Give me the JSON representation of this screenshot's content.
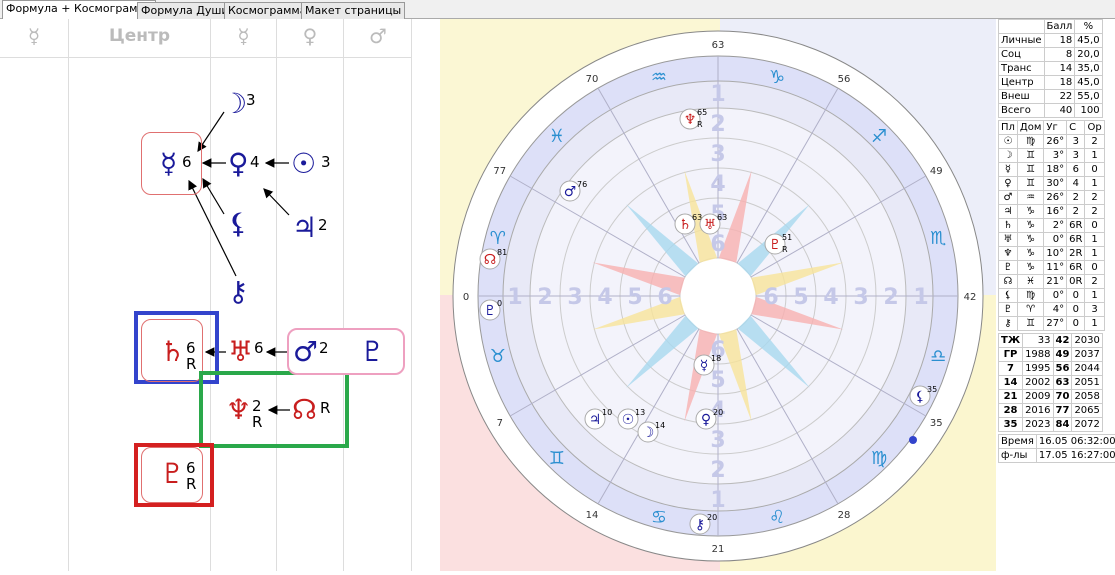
{
  "tabs": [
    "Формула + Космограмма",
    "Формула Души",
    "Космограмма",
    "Макет страницы"
  ],
  "formula": {
    "headers": [
      "☿",
      "Центр",
      "☿",
      "♀",
      "♂"
    ],
    "planets": [
      {
        "key": "moon",
        "glyph": "☽",
        "num": "3",
        "color": "#1a1a9a"
      },
      {
        "key": "mercury",
        "glyph": "☿",
        "num": "6",
        "color": "#1a1a9a"
      },
      {
        "key": "venus",
        "glyph": "♀",
        "num": "4",
        "color": "#1a1a9a"
      },
      {
        "key": "sun",
        "glyph": "☉",
        "num": "3",
        "color": "#1a1a9a"
      },
      {
        "key": "lilith",
        "glyph": "⚸",
        "num": "",
        "color": "#1a1a9a"
      },
      {
        "key": "jupiter",
        "glyph": "♃",
        "num": "2",
        "color": "#1a1a9a"
      },
      {
        "key": "chiron",
        "glyph": "⚷",
        "num": "",
        "color": "#1a1a9a"
      },
      {
        "key": "saturn",
        "glyph": "♄",
        "num": "6",
        "r": "R",
        "color": "#c81e1e"
      },
      {
        "key": "uranus",
        "glyph": "♅",
        "num": "6",
        "color": "#c81e1e"
      },
      {
        "key": "mars",
        "glyph": "♂",
        "num": "2",
        "color": "#1a1a9a"
      },
      {
        "key": "pluto_blue",
        "glyph": "♇",
        "num": "",
        "color": "#1a1a9a"
      },
      {
        "key": "neptune",
        "glyph": "♆",
        "num": "2",
        "r": "R",
        "color": "#c81e1e"
      },
      {
        "key": "node",
        "glyph": "☊",
        "num": "R",
        "color": "#c81e1e"
      },
      {
        "key": "pluto",
        "glyph": "♇",
        "num": "6",
        "r": "R",
        "color": "#c81e1e"
      }
    ]
  },
  "chart": {
    "degree_labels": [
      "63",
      "56",
      "49",
      "42",
      "35",
      "28",
      "21",
      "14",
      "7",
      "0",
      "77",
      "70"
    ],
    "signs": [
      "♑",
      "♐",
      "♏",
      "♎",
      "♍",
      "♌",
      "♋",
      "♊",
      "♉",
      "♈",
      "♓",
      "♒"
    ],
    "inner_numbers": [
      "6",
      "5",
      "4",
      "3",
      "2",
      "1"
    ],
    "planets": [
      {
        "name": "neptune-marker",
        "glyph": "♆",
        "label": "65",
        "r": "R",
        "color": "#c81e1e"
      },
      {
        "name": "mars-marker",
        "glyph": "♂",
        "label": "76",
        "color": "#1a1a9a"
      },
      {
        "name": "saturn-marker",
        "glyph": "♄",
        "label": "63",
        "color": "#c81e1e"
      },
      {
        "name": "uranus-marker",
        "glyph": "♅",
        "label": "63",
        "color": "#c81e1e"
      },
      {
        "name": "pluto-marker",
        "glyph": "♇",
        "label": "51",
        "r": "R",
        "color": "#c81e1e"
      },
      {
        "name": "node-marker",
        "glyph": "☊",
        "label": "81",
        "color": "#c81e1e"
      },
      {
        "name": "pluto2-marker",
        "glyph": "♇",
        "label": "0",
        "color": "#1a1a9a"
      },
      {
        "name": "mercury-marker",
        "glyph": "☿",
        "label": "18",
        "color": "#1a1a9a"
      },
      {
        "name": "jupiter-marker",
        "glyph": "♃",
        "label": "10",
        "color": "#1a1a9a"
      },
      {
        "name": "sun-marker",
        "glyph": "☉",
        "label": "13",
        "color": "#1a1a9a"
      },
      {
        "name": "moon-marker",
        "glyph": "☽",
        "label": "14",
        "color": "#1a1a9a"
      },
      {
        "name": "venus-marker",
        "glyph": "♀",
        "label": "20",
        "color": "#1a1a9a"
      },
      {
        "name": "lilith-marker",
        "glyph": "⚸",
        "label": "35",
        "color": "#1a1a9a"
      },
      {
        "name": "chiron-marker",
        "glyph": "⚷",
        "label": "20",
        "color": "#1a1a9a"
      }
    ]
  },
  "score_table": {
    "headers": [
      "",
      "Балл",
      "%"
    ],
    "rows": [
      [
        "Личные",
        "18",
        "45,0"
      ],
      [
        "Соц",
        "8",
        "20,0"
      ],
      [
        "Транс",
        "14",
        "35,0"
      ],
      [
        "Центр",
        "18",
        "45,0"
      ],
      [
        "Внеш",
        "22",
        "55,0"
      ],
      [
        "Всего",
        "40",
        "100"
      ]
    ]
  },
  "planet_table": {
    "headers": [
      "Пл",
      "Дом",
      "Уг",
      "С",
      "Ор"
    ],
    "rows": [
      [
        "☉",
        "♍",
        "26°",
        "3",
        "2"
      ],
      [
        "☽",
        "♊",
        "3°",
        "3",
        "1"
      ],
      [
        "☿",
        "♊",
        "18°",
        "6",
        "0"
      ],
      [
        "♀",
        "♊",
        "30°",
        "4",
        "1"
      ],
      [
        "♂",
        "♒",
        "26°",
        "2",
        "2"
      ],
      [
        "♃",
        "♑",
        "16°",
        "2",
        "2"
      ],
      [
        "♄",
        "♑",
        "2°",
        "6R",
        "0"
      ],
      [
        "♅",
        "♑",
        "0°",
        "6R",
        "1"
      ],
      [
        "♆",
        "♑",
        "10°",
        "2R",
        "1"
      ],
      [
        "♇",
        "♑",
        "11°",
        "6R",
        "0"
      ],
      [
        "☊",
        "♓",
        "21°",
        "0R",
        "2"
      ],
      [
        "⚸",
        "♍",
        "0°",
        "0",
        "1"
      ],
      [
        "♇",
        "♈",
        "4°",
        "0",
        "3"
      ],
      [
        "⚷",
        "♊",
        "27°",
        "0",
        "1"
      ]
    ]
  },
  "years_table": {
    "rows": [
      [
        "ТЖ",
        "33",
        "42",
        "2030"
      ],
      [
        "ГР",
        "1988",
        "49",
        "2037"
      ],
      [
        "7",
        "1995",
        "56",
        "2044"
      ],
      [
        "14",
        "2002",
        "63",
        "2051"
      ],
      [
        "21",
        "2009",
        "70",
        "2058"
      ],
      [
        "28",
        "2016",
        "77",
        "2065"
      ],
      [
        "35",
        "2023",
        "84",
        "2072"
      ]
    ]
  },
  "time_table": {
    "rows": [
      [
        "Время",
        "16.05 06:32:00"
      ],
      [
        "ф-лы",
        "17.05 16:27:00"
      ]
    ]
  }
}
